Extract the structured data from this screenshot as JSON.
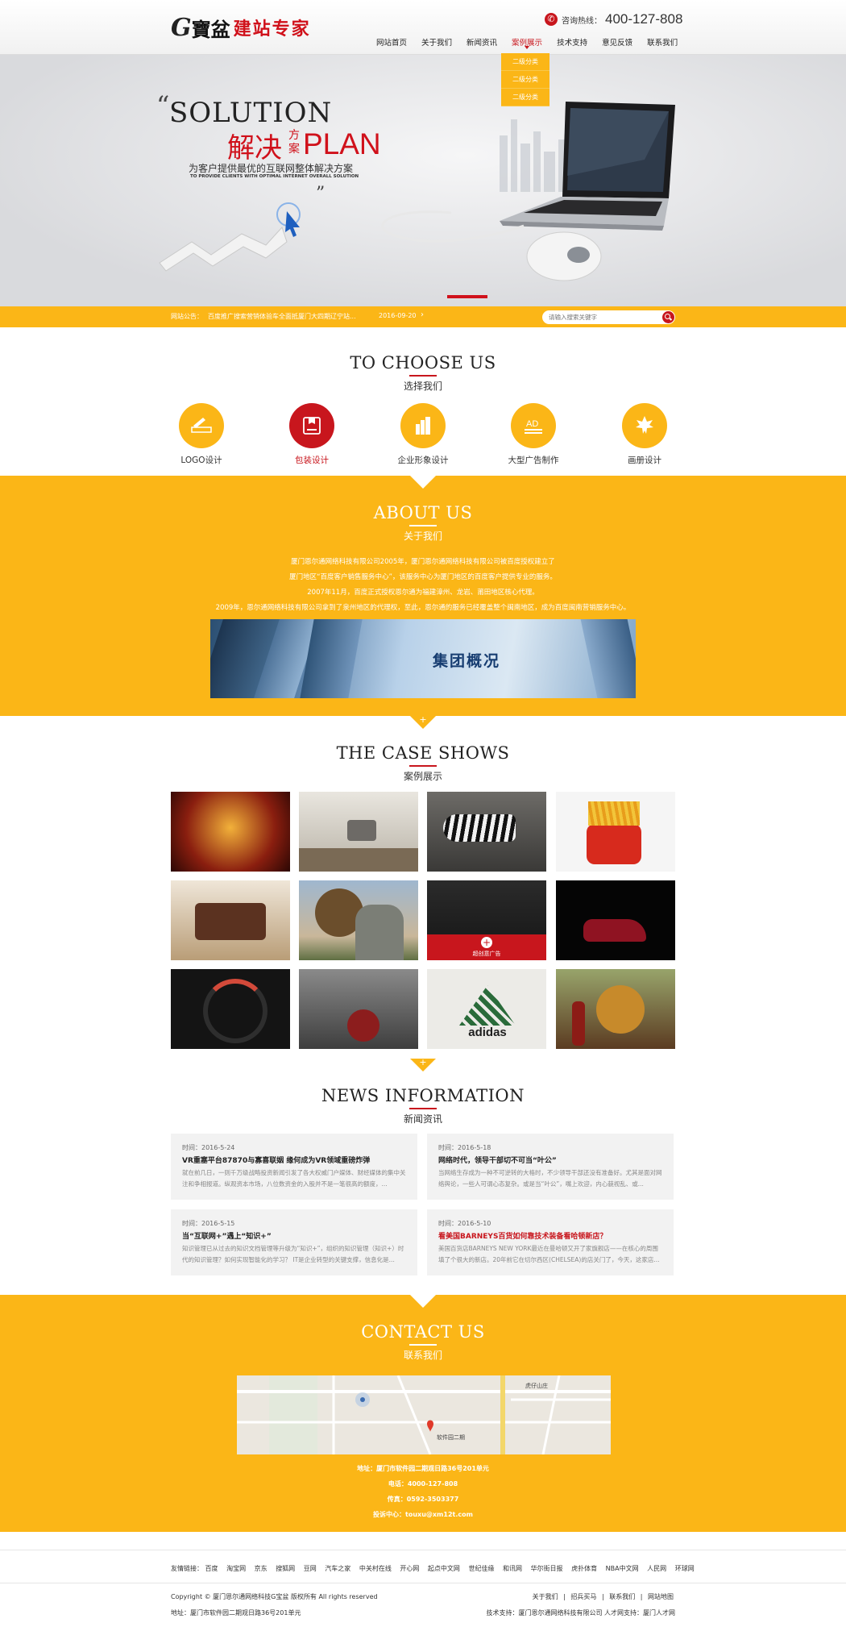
{
  "header": {
    "logo_g": "G",
    "logo_brand": "寶盆",
    "logo_slogan": "建站专家",
    "hotline_label": "咨询热线：",
    "hotline_number": "400-127-808",
    "nav": [
      "网站首页",
      "关于我们",
      "新闻资讯",
      "案例展示",
      "技术支持",
      "意见反馈",
      "联系我们"
    ],
    "active_nav": "案例展示",
    "dropdown": [
      "二级分类",
      "二级分类",
      "二级分类"
    ]
  },
  "banner": {
    "headline_en": "SOLUTION",
    "headline_cn": "解决",
    "headline_small": "方案",
    "headline_plan": "PLAN",
    "subtitle": "为客户提供最优的互联网整体解决方案",
    "subtitle_en": "TO PROVIDE CLIENTS WITH OPTIMAL INTERNET OVERALL SOLUTION",
    "quote_open": "“",
    "quote_close": "”"
  },
  "notice": {
    "label": "网站公告：",
    "text": "百度推广搜索营销体验车全面抵厦门大四期辽宁站...",
    "date": "2016-09-20",
    "arrow": "›",
    "search_placeholder": "请输入搜索关键字"
  },
  "choose": {
    "title_en": "TO CHOOSE US",
    "title_cn": "选择我们",
    "items": [
      {
        "label": "LOGO设计",
        "icon": "pen-ruler-icon",
        "highlight": false
      },
      {
        "label": "包装设计",
        "icon": "package-icon",
        "highlight": true
      },
      {
        "label": "企业形象设计",
        "icon": "building-icon",
        "highlight": false
      },
      {
        "label": "大型广告制作",
        "icon": "ad-icon",
        "highlight": false
      },
      {
        "label": "画册设计",
        "icon": "maple-leaf-icon",
        "highlight": false
      }
    ]
  },
  "about": {
    "title_en": "ABOUT US",
    "title_cn": "关于我们",
    "paragraphs": [
      "厦门恩尔通网络科技有限公司2005年，厦门恩尔通网络科技有限公司被百度授权建立了",
      "厦门地区“百度客户销售服务中心”，该服务中心为厦门地区的百度客户提供专业的服务。",
      "2007年11月，百度正式授权恩尔通为福建漳州、龙岩、莆田地区核心代理。",
      "2009年，恩尔通网络科技有限公司拿到了泉州地区的代理权，至此，恩尔通的服务已经覆盖整个闽南地区，成为百度闽南营销服务中心。"
    ],
    "banner_title": "集团概况"
  },
  "cases": {
    "title_en": "THE CASE SHOWS",
    "title_cn": "案例展示",
    "overlay_plus": "+",
    "overlay_label": "超创意广告"
  },
  "news": {
    "title_en": "NEWS INFORMATION",
    "title_cn": "新闻资讯",
    "items": [
      {
        "date": "时间：2016-5-24",
        "title": "VR重塞平台87870与寡喜联姻 缘何成为VR领域重磅炸弹",
        "body": "就在前几日，一则千万级战略投资新闻引发了各大权威门户媒体、财经媒体的集中关注和争相报道。纵观资本市场，八位数资金的入股并不是一笔很高的额度，...",
        "red": false
      },
      {
        "date": "时间：2016-5-18",
        "title": "网络时代，领导干部切不可当“叶公”",
        "body": "当网络生存成为一种不可逆转的大格时，不少领导干部还没有准备好。尤其是面对网络舆论，一些人可谓心态复杂。或是当“叶公”，嘴上欢迎，内心藐视乱、或...",
        "red": false
      },
      {
        "date": "时间：2016-5-15",
        "title": "当“互联网+”遇上“知识+”",
        "body": "知识管理已从过去的知识文档管理等升级为“知识+”，组织的知识管理（知识+）时代的知识管理？如何实现智能化的学习？ IT是企业转型的关键支撑，信息化是...",
        "red": false
      },
      {
        "date": "时间：2016-5-10",
        "title": "看美国BARNEYS百货如何靠技术装备看哈顿新店？",
        "body": "美国百货店BARNEYS NEW YORK最近在曼哈顿又开了家旗舰店——在核心的周围填了个很大的新店。20年前它在切尔西区(CHELSEA)的店关门了，今天，这家店...",
        "red": true
      }
    ]
  },
  "contact": {
    "title_en": "CONTACT US",
    "title_cn": "联系我们",
    "address": "地址：厦门市软件园二期观日路36号201单元",
    "phone": "电话：4000-127-808",
    "fax": "传真：0592-3503377",
    "investment": "投诉中心：touxu@xm12t.com",
    "map_labels": [
      "虎仔山庄",
      "软件园二期"
    ]
  },
  "links": {
    "label": "友情链接：",
    "items": [
      "百度",
      "淘宝网",
      "京东",
      "搜狐网",
      "豆网",
      "汽车之家",
      "中关村在线",
      "开心网",
      "起点中文网",
      "世纪佳缘",
      "和讯网",
      "华尔街日报",
      "虎扑体育",
      "NBA中文网",
      "人民网",
      "环球网"
    ]
  },
  "footer": {
    "copyright": "Copyright © 厦门恩尔通网络科技G宝盆 版权所有 All rights reserved",
    "address": "地址：厦门市软件园二期观日路36号201单元",
    "links": [
      "关于我们",
      "招兵买马",
      "联系我们",
      "网站地图"
    ],
    "sep": "|",
    "support": "技术支持：厦门恩尔通网络科技有限公司 人才网支持：厦门人才网"
  },
  "colors": {
    "accent": "#fbb617",
    "brand_red": "#c8161d"
  }
}
